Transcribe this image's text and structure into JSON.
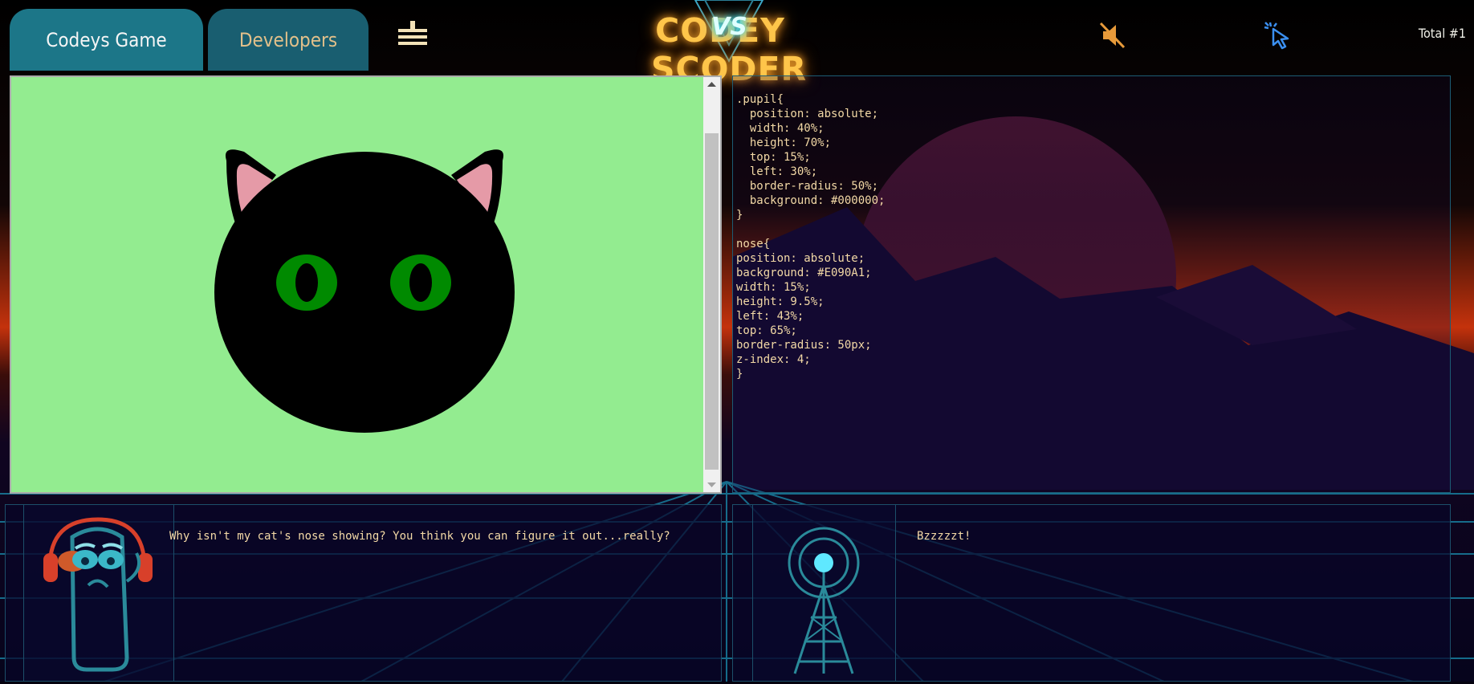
{
  "nav": {
    "tabs": [
      {
        "label": "Codeys Game",
        "active": true
      },
      {
        "label": "Developers",
        "active": false
      }
    ],
    "menu_icon": "plus-bars-icon",
    "logo": {
      "text": "CODEYSCODER",
      "vs": "VS",
      "alt": "Codey vs Coder"
    },
    "mute_icon": "speaker-muted-icon",
    "cursor_icon": "cursor-click-icon",
    "total_label": "Total #1"
  },
  "preview": {
    "background_color": "#93ec90",
    "subject": "black cat face with green eyes and pink ears"
  },
  "code_editor": {
    "lines": [
      ".pupil{",
      "  position: absolute;",
      "  width: 40%;",
      "  height: 70%;",
      "  top: 15%;",
      "  left: 30%;",
      "  border-radius: 50%;",
      "  background: #000000;",
      "}",
      "",
      "nose{",
      "position: absolute;",
      "background: #E090A1;",
      "width: 15%;",
      "height: 9.5%;",
      "left: 43%;",
      "top: 65%;",
      "border-radius: 50px;",
      "z-index: 4;",
      "}"
    ]
  },
  "chat": {
    "codey": {
      "avatar_icon": "codey-headphones-icon",
      "message": "Why isn't my cat's nose showing? You think you can figure it out...really?"
    },
    "tower": {
      "avatar_icon": "radio-tower-icon",
      "message": "Bzzzzzt!"
    }
  },
  "colors": {
    "accent_gold": "#f3d9a6",
    "tab_teal": "#1c7688",
    "neon_cyan": "#30e0ff",
    "cat_eye_green": "#008a00",
    "cat_ear_pink": "#e59aa7"
  }
}
